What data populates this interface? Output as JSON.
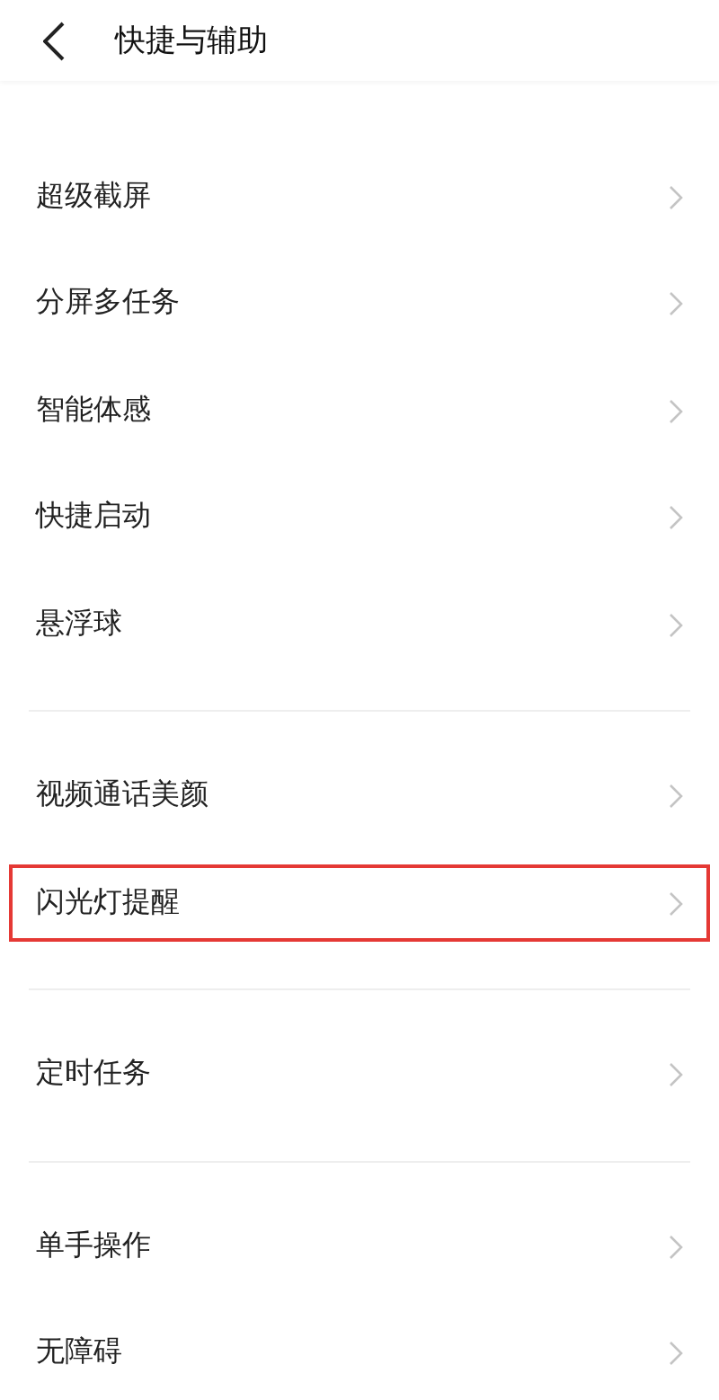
{
  "header": {
    "title": "快捷与辅助"
  },
  "sections": [
    {
      "items": [
        {
          "label": "超级截屏",
          "highlighted": false
        },
        {
          "label": "分屏多任务",
          "highlighted": false
        },
        {
          "label": "智能体感",
          "highlighted": false
        },
        {
          "label": "快捷启动",
          "highlighted": false
        },
        {
          "label": "悬浮球",
          "highlighted": false
        }
      ]
    },
    {
      "items": [
        {
          "label": "视频通话美颜",
          "highlighted": false
        },
        {
          "label": "闪光灯提醒",
          "highlighted": true
        }
      ]
    },
    {
      "items": [
        {
          "label": "定时任务",
          "highlighted": false
        }
      ]
    },
    {
      "items": [
        {
          "label": "单手操作",
          "highlighted": false
        },
        {
          "label": "无障碍",
          "highlighted": false
        }
      ]
    }
  ]
}
